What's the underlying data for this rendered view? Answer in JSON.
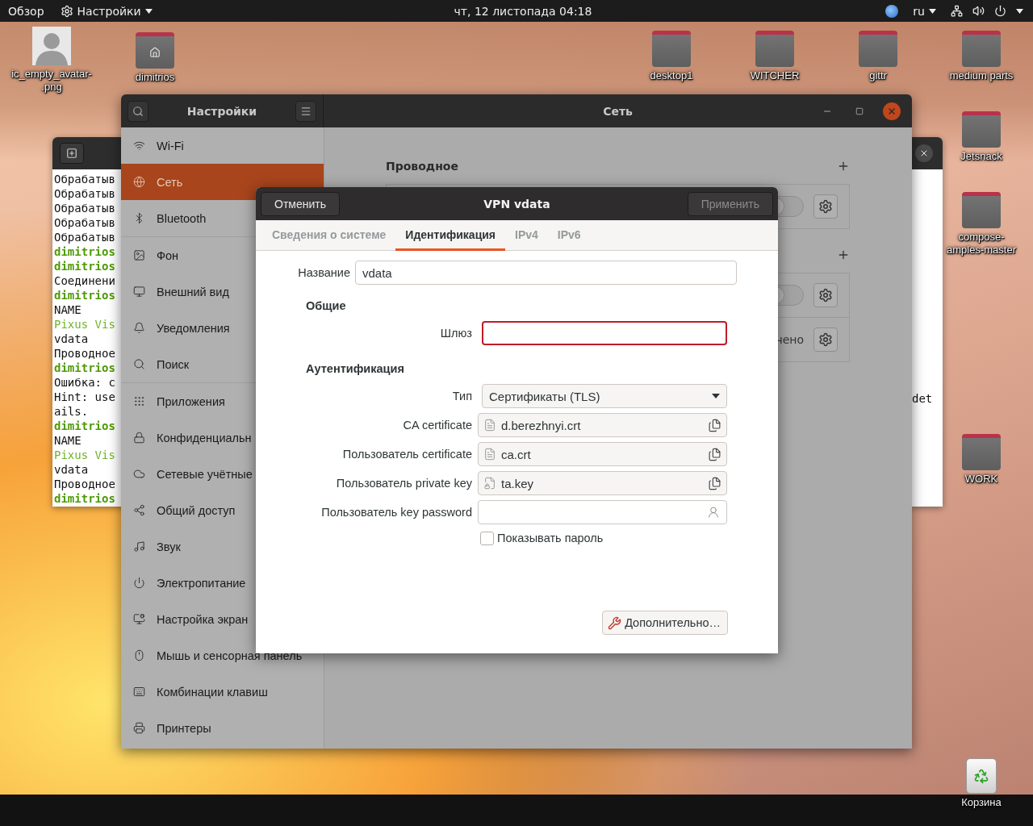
{
  "top_bar": {
    "activities": "Обзор",
    "app_menu": "Настройки",
    "clock": "чт, 12 листопада  04:18",
    "keyboard_layout": "ru"
  },
  "desktop_icons": [
    {
      "kind": "avatar",
      "label": "ic_empty_avatar-\n.png"
    },
    {
      "kind": "home",
      "label": "dimitrios"
    },
    {
      "kind": "folder",
      "label": "desktop1"
    },
    {
      "kind": "folder",
      "label": "WITCHER"
    },
    {
      "kind": "folder",
      "label": "gittr"
    },
    {
      "kind": "folder",
      "label": "medium parts"
    },
    {
      "kind": "folder",
      "label": "Jetsnack"
    },
    {
      "kind": "folder",
      "label": "compose-\namples-master"
    },
    {
      "kind": "folder",
      "label": "WORK"
    },
    {
      "kind": "trash",
      "label": "Корзина"
    }
  ],
  "terminal": {
    "lines": [
      {
        "kind": "output",
        "text": "Обрабатыв"
      },
      {
        "kind": "output",
        "text": "Обрабатыв"
      },
      {
        "kind": "output",
        "text": "Обрабатыв"
      },
      {
        "kind": "output",
        "text": "Обрабатыв"
      },
      {
        "kind": "output",
        "text": "Обрабатыв"
      },
      {
        "kind": "prompt",
        "text": "dimitrios"
      },
      {
        "kind": "prompt",
        "text": "dimitrios"
      },
      {
        "kind": "output",
        "text": "Соединени"
      },
      {
        "kind": "prompt",
        "text": "dimitrios"
      },
      {
        "kind": "output",
        "text": "NAME"
      },
      {
        "kind": "accent",
        "text": "Pixus Vis"
      },
      {
        "kind": "output",
        "text": "vdata"
      },
      {
        "kind": "output",
        "text": "Проводное"
      },
      {
        "kind": "prompt",
        "text": "dimitrios"
      },
      {
        "kind": "output",
        "text": "Ошибка: c"
      },
      {
        "kind": "output",
        "text": "Hint: use"
      },
      {
        "kind": "output",
        "text": "ails."
      },
      {
        "kind": "prompt",
        "text": "dimitrios"
      },
      {
        "kind": "output",
        "text": "NAME"
      },
      {
        "kind": "accent",
        "text": "Pixus Vis"
      },
      {
        "kind": "output",
        "text": "vdata"
      },
      {
        "kind": "output",
        "text": "Проводное"
      },
      {
        "kind": "prompt",
        "text": "dimitrios"
      }
    ]
  },
  "back_window": {
    "text": "det"
  },
  "settings": {
    "title": "Настройки",
    "panel_title": "Сеть",
    "sidebar_groups": [
      [
        {
          "label": "Wi-Fi",
          "selected": false
        },
        {
          "label": "Сеть",
          "selected": true
        },
        {
          "label": "Bluetooth",
          "selected": false
        }
      ],
      [
        {
          "label": "Фон",
          "selected": false
        },
        {
          "label": "Внешний вид",
          "selected": false
        },
        {
          "label": "Уведомления",
          "selected": false
        },
        {
          "label": "Поиск",
          "selected": false
        }
      ],
      [
        {
          "label": "Приложения",
          "selected": false
        },
        {
          "label": "Конфиденциальн",
          "selected": false
        },
        {
          "label": "Сетевые учётные",
          "selected": false
        },
        {
          "label": "Общий доступ",
          "selected": false
        },
        {
          "label": "Звук",
          "selected": false
        },
        {
          "label": "Электропитание",
          "selected": false
        },
        {
          "label": "Настройка экран",
          "selected": false
        },
        {
          "label": "Мышь и сенсорная панель",
          "selected": false
        },
        {
          "label": "Комбинации клавиш",
          "selected": false
        },
        {
          "label": "Принтеры",
          "selected": false
        }
      ]
    ],
    "sections": [
      {
        "title": "Проводное",
        "rows": [
          {
            "kind": "switch",
            "on": false
          }
        ]
      },
      {
        "rows": [
          {
            "kind": "switch",
            "on": false
          },
          {
            "kind": "status",
            "status": "чено"
          }
        ]
      }
    ]
  },
  "dialog": {
    "title": "VPN vdata",
    "cancel": "Отменить",
    "apply": "Применить",
    "apply_disabled": true,
    "tabs": [
      {
        "label": "Сведения о системе",
        "selected": false
      },
      {
        "label": "Идентификация",
        "selected": true
      },
      {
        "label": "IPv4",
        "selected": false
      },
      {
        "label": "IPv6",
        "selected": false
      }
    ],
    "name_label": "Название",
    "name_value": "vdata",
    "sections": [
      {
        "title": "Общие",
        "fields": [
          {
            "kind": "entry",
            "label": "Шлюз",
            "invalid": true
          }
        ]
      },
      {
        "title": "Аутентификация",
        "fields": [
          {
            "kind": "combo",
            "label": "Тип",
            "value": "Сертификаты (TLS)"
          },
          {
            "kind": "file",
            "label": "CA certificate",
            "value": "d.berezhnyi.crt"
          },
          {
            "kind": "file",
            "label": "Пользователь certificate",
            "value": "ca.crt"
          },
          {
            "kind": "key-file",
            "label": "Пользователь private key",
            "value": "ta.key"
          },
          {
            "kind": "password",
            "label": "Пользователь key password"
          }
        ]
      }
    ],
    "show_password": {
      "label": "Показывать пароль",
      "checked": false
    },
    "advanced": "Дополнительно…"
  }
}
